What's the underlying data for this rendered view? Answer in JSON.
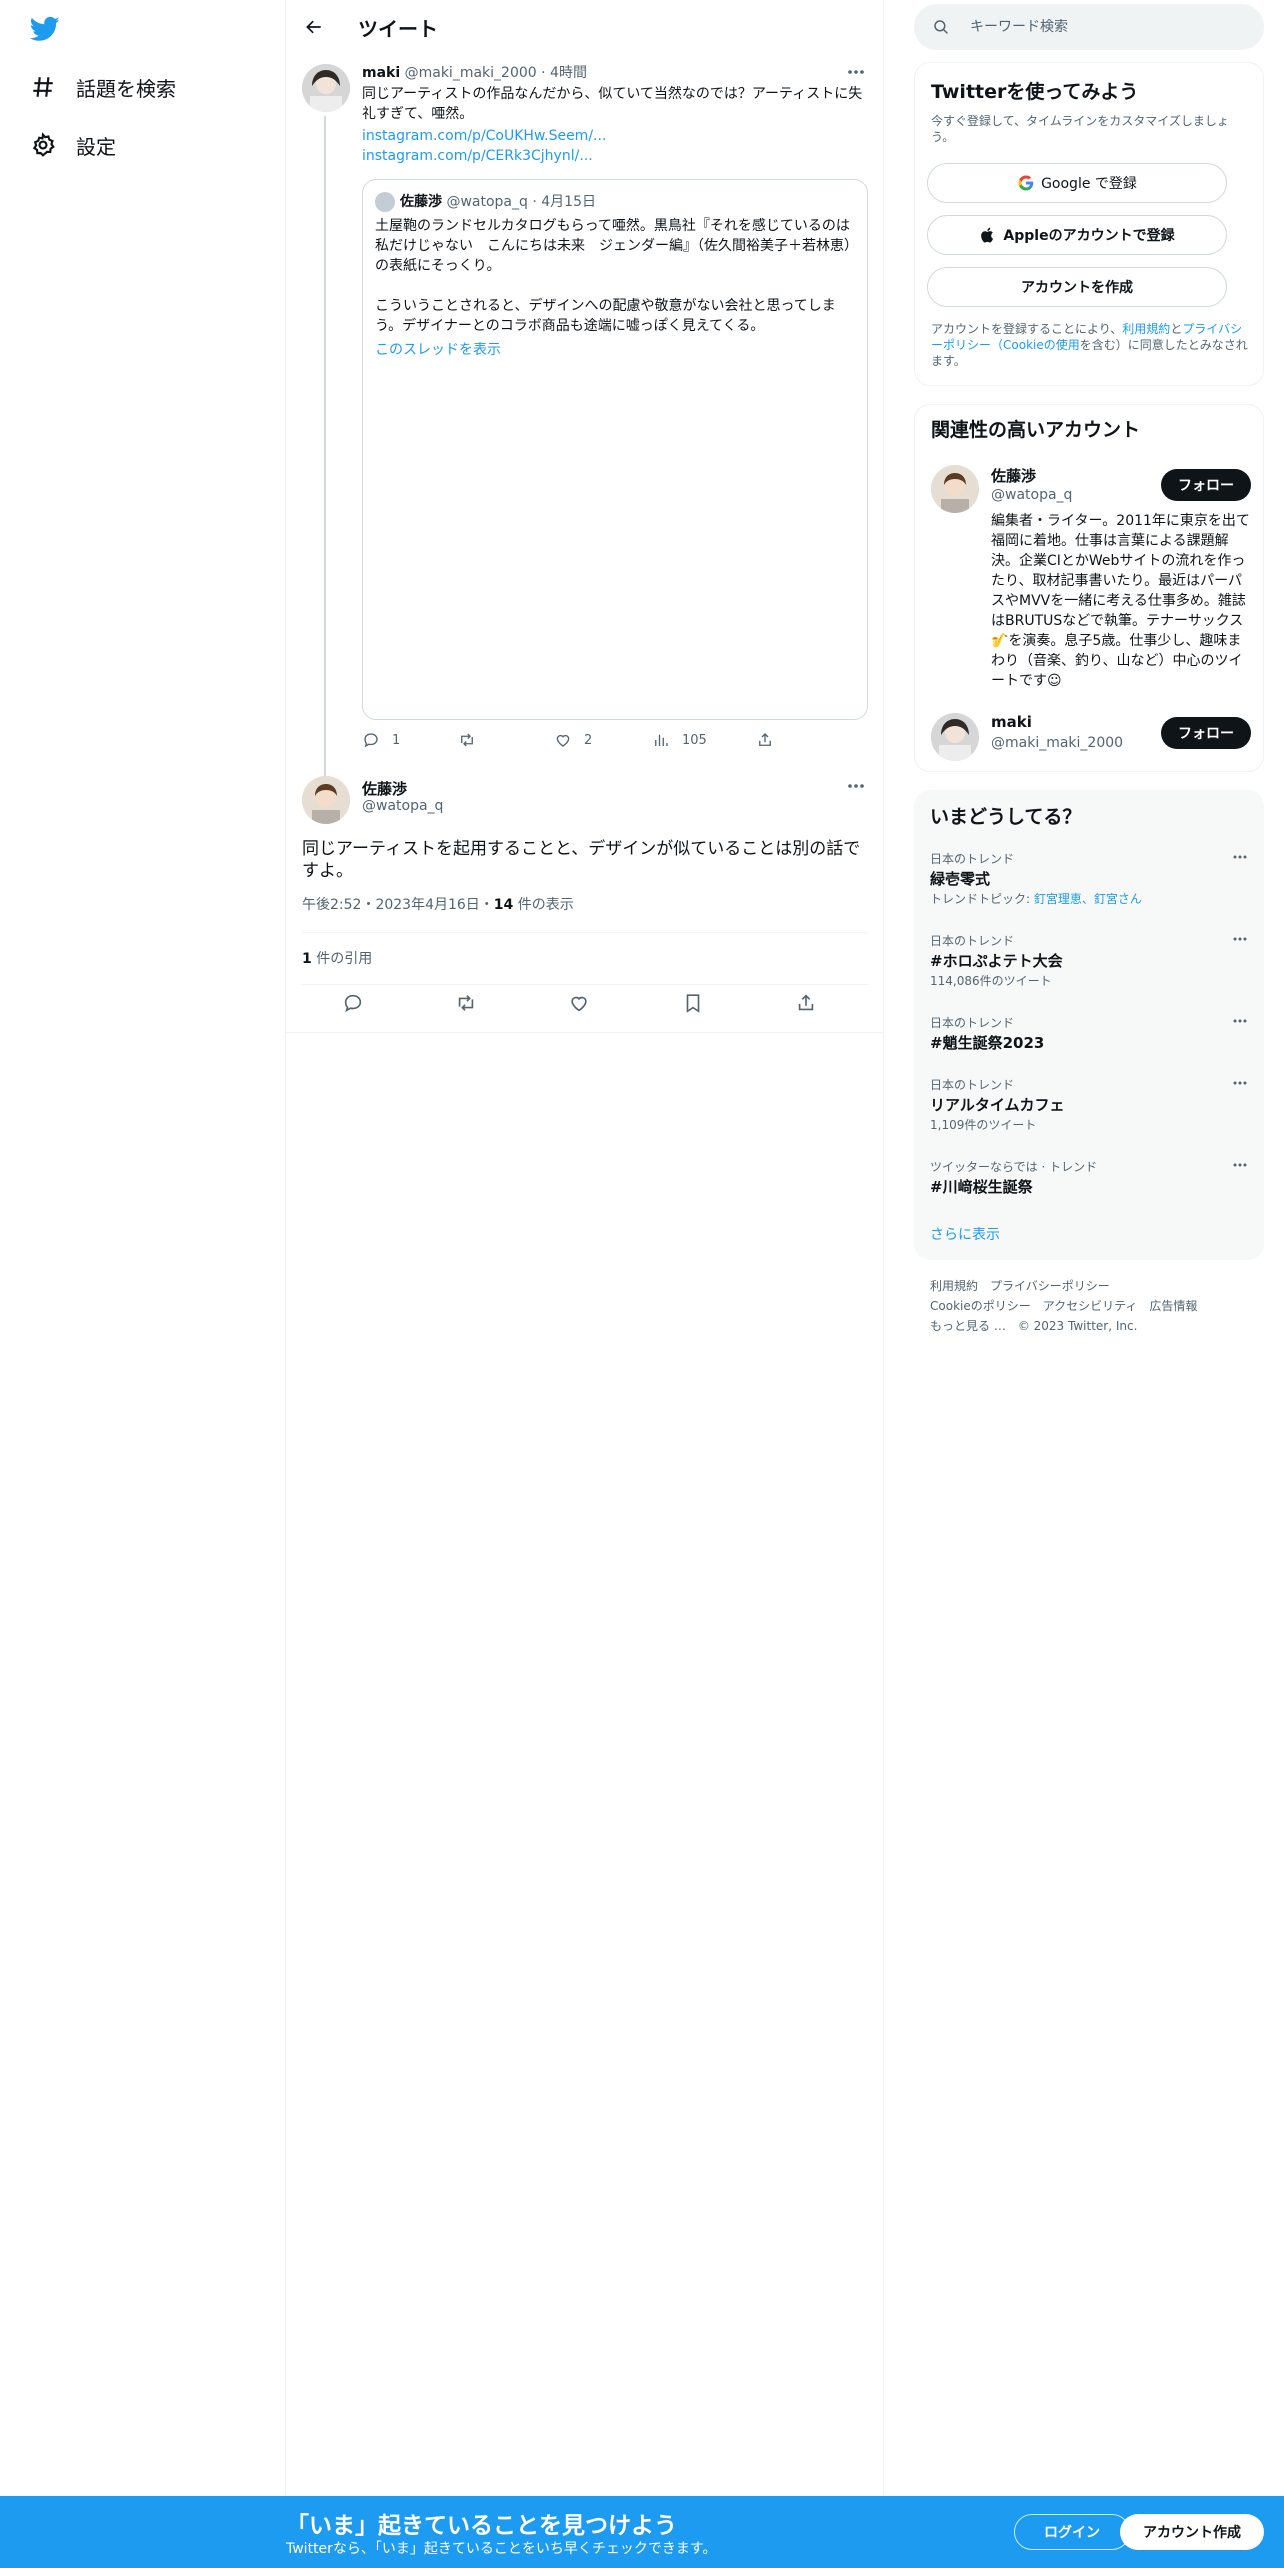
{
  "nav": {
    "items": [
      {
        "label": "話題を検索",
        "icon": "hashtag-icon"
      },
      {
        "label": "設定",
        "icon": "gear-icon"
      }
    ]
  },
  "header": {
    "title": "ツイート"
  },
  "parent_tweet": {
    "name": "maki",
    "handle": "@maki_maki_2000",
    "time": "4時間",
    "text": "同じアーティストの作品なんだから、似ていて当然なのでは？アーティストに失礼すぎて、唖然。",
    "links": [
      "instagram.com/p/CoUKHw.Seem/...",
      "instagram.com/p/CERk3Cjhynl/..."
    ],
    "quote": {
      "name": "佐藤渉",
      "handle": "@watopa_q",
      "date": "4月15日",
      "text_1": "土屋鞄のランドセルカタログもらって唖然。黒鳥社『それを感じているのは私だけじゃない　こんにちは未来　ジェンダー編』（佐久間裕美子＋若林恵）の表紙にそっくり。",
      "text_2": "こういうことされると、デザインへの配慮や敬意がない会社と思ってしまう。デザイナーとのコラボ商品も途端に嘘っぽく見えてくる。",
      "thread_link": "このスレッドを表示"
    },
    "stats": {
      "replies": "1",
      "retweets": "",
      "likes": "2",
      "views": "105"
    }
  },
  "focus_tweet": {
    "name": "佐藤渉",
    "handle": "@watopa_q",
    "text": "同じアーティストを起用することと、デザインが似ていることは別の話ですよ。",
    "time": "午後2:52・2023年4月16日・",
    "views_count": "14",
    "views_label": " 件の表示",
    "quotes_count": "1",
    "quotes_label": " 件の引用"
  },
  "search": {
    "placeholder": "キーワード検索"
  },
  "signup_card": {
    "title": "Twitterを使ってみよう",
    "subtitle": "今すぐ登録して、タイムラインをカスタマイズしましょう。",
    "google": "Google で登録",
    "apple": "Appleのアカウントで登録",
    "create": "アカウントを作成",
    "terms_pre": "アカウントを登録することにより、",
    "terms_link": "利用規約",
    "terms_mid": "と",
    "privacy_link": "プライバシーポリシー（Cookieの使用",
    "terms_post": "を含む）に同意したとみなされます。"
  },
  "related": {
    "title": "関連性の高いアカウント",
    "follow_label": "フォロー",
    "accounts": [
      {
        "name": "佐藤渉",
        "handle": "@watopa_q",
        "bio": "編集者・ライター。2011年に東京を出て福岡に着地。仕事は言葉による課題解決。企業CIとかWebサイトの流れを作ったり、取材記事書いたり。最近はパーパスやMVVを一緒に考える仕事多め。雑誌はBRUTUSなどで執筆。テナーサックス🎷を演奏。息子5歳。仕事少し、趣味まわり（音楽、釣り、山など）中心のツイートです☺"
      },
      {
        "name": "maki",
        "handle": "@maki_maki_2000",
        "bio": ""
      }
    ]
  },
  "trends": {
    "title": "いまどうしてる？",
    "items": [
      {
        "context": "日本のトレンド",
        "title": "緑壱零式",
        "sub_prefix": "トレンドトピック: ",
        "sub_links": "釘宮理恵、釘宮さん"
      },
      {
        "context": "日本のトレンド",
        "title": "#ホロぷよテト大会",
        "sub": "114,086件のツイート"
      },
      {
        "context": "日本のトレンド",
        "title": "#魈生誕祭2023",
        "sub": ""
      },
      {
        "context": "日本のトレンド",
        "title": "リアルタイムカフェ",
        "sub": "1,109件のツイート"
      },
      {
        "context": "ツイッターならでは · トレンド",
        "title": "#川﨑桜生誕祭",
        "sub": ""
      }
    ],
    "show_more": "さらに表示"
  },
  "footer": {
    "links_row1": [
      "利用規約",
      "プライバシーポリシー"
    ],
    "links_row2": [
      "Cookieのポリシー",
      "アクセシビリティ",
      "広告情報"
    ],
    "more": "もっと見る …",
    "copyright": "© 2023 Twitter, Inc."
  },
  "bottom_bar": {
    "title": "「いま」起きていることを見つけよう",
    "subtitle": "Twitterなら、「いま」起きていることをいち早くチェックできます。",
    "login": "ログイン",
    "signup": "アカウント作成"
  },
  "colors": {
    "brand": "#1d9bf0",
    "text": "#0f1419",
    "muted": "#536471"
  }
}
